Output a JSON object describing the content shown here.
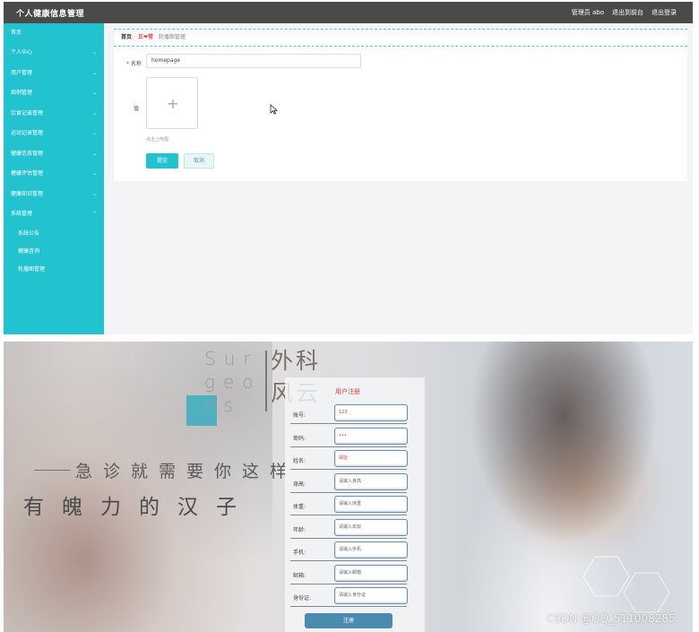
{
  "admin": {
    "app_title": "个人健康信息管理",
    "topbar": {
      "admin_label": "管理员 abo",
      "to_front": "退出到前台",
      "logout": "退出登录"
    },
    "sidebar": {
      "items": [
        {
          "label": "首页",
          "chevron": false
        },
        {
          "label": "个人中心",
          "chevron": true
        },
        {
          "label": "用户管理",
          "chevron": true
        },
        {
          "label": "病例管理",
          "chevron": true
        },
        {
          "label": "饮食记录管理",
          "chevron": true
        },
        {
          "label": "运动记录管理",
          "chevron": true
        },
        {
          "label": "健康信息管理",
          "chevron": true
        },
        {
          "label": "健康评估管理",
          "chevron": true
        },
        {
          "label": "健康知识管理",
          "chevron": true
        },
        {
          "label": "系统管理",
          "chevron": true
        }
      ],
      "sub_items": [
        "系统公告",
        "健康咨询",
        "轮播图管理"
      ]
    },
    "breadcrumb": {
      "home": "首页",
      "middle": "正❤常",
      "current": "轮播图管理"
    },
    "form": {
      "name_label": "名称",
      "name_required_mark": "*",
      "name_value": "homepage",
      "image_label": "值",
      "upload_plus": "+",
      "upload_hint": "点击上传图",
      "submit_label": "提交",
      "cancel_label": "取消"
    }
  },
  "register": {
    "en_title": [
      "Sur",
      "geo",
      "ns"
    ],
    "cn_title": [
      "外科",
      "风云"
    ],
    "slogan_line1": "急诊就需要你这样",
    "slogan_line2": "有魄力的汉子",
    "panel_title": "用户注册",
    "fields": [
      {
        "label": "账号:",
        "value": "123",
        "red": true
      },
      {
        "label": "密码:",
        "value": "•••",
        "red": true
      },
      {
        "label": "姓名:",
        "value": "胡扯",
        "red": true
      },
      {
        "label": "身高:",
        "value": "请输入身高",
        "red": false
      },
      {
        "label": "体重:",
        "value": "请输入体重",
        "red": false
      },
      {
        "label": "年龄:",
        "value": "请输入年龄",
        "red": false
      },
      {
        "label": "手机:",
        "value": "请输入手机",
        "red": false
      },
      {
        "label": "邮箱:",
        "value": "请输入邮箱",
        "red": false
      },
      {
        "label": "身份证:",
        "value": "请输入身份证",
        "red": false
      }
    ],
    "register_button": "注册",
    "watermark": "CSDN @QQ_511008285"
  },
  "colors": {
    "accent_teal": "#22c2cf",
    "topbar_dark": "#4a4a4a",
    "required_red": "#e03d3d",
    "register_button": "#4a8cb0"
  }
}
